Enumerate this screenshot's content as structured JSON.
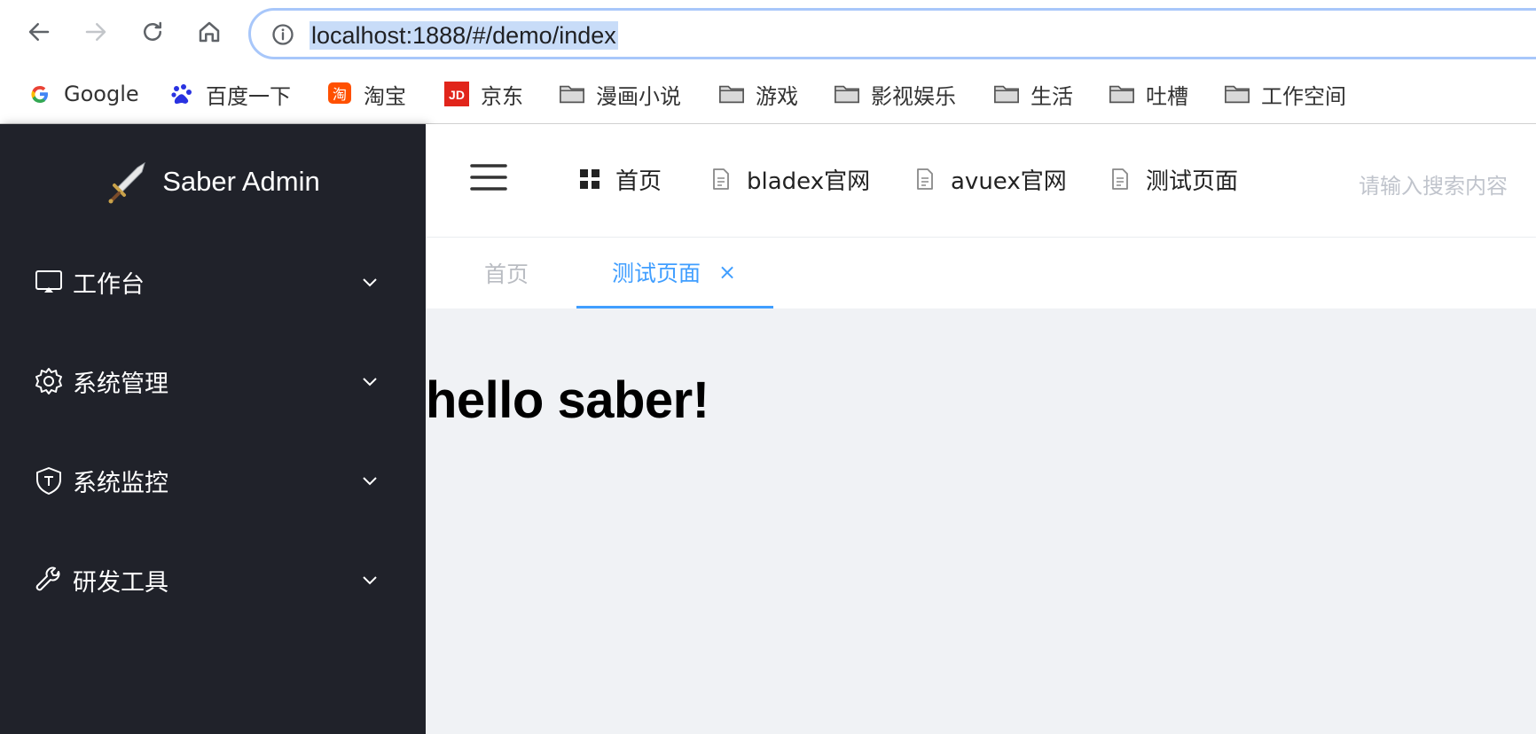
{
  "browser": {
    "url": "localhost:1888/#/demo/index",
    "icons": [
      "back-arrow-icon",
      "forward-arrow-icon",
      "reload-icon",
      "home-icon",
      "info-icon"
    ]
  },
  "bookmarks": [
    {
      "label": "Google",
      "icon": "google-icon"
    },
    {
      "label": "百度一下",
      "icon": "baidu-paw-icon"
    },
    {
      "label": "淘宝",
      "icon": "taobao-icon"
    },
    {
      "label": "京东",
      "icon": "jd-icon"
    },
    {
      "label": "漫画小说",
      "icon": "folder-icon"
    },
    {
      "label": "游戏",
      "icon": "folder-icon"
    },
    {
      "label": "影视娱乐",
      "icon": "folder-icon"
    },
    {
      "label": "生活",
      "icon": "folder-icon"
    },
    {
      "label": "吐槽",
      "icon": "folder-icon"
    },
    {
      "label": "工作空间",
      "icon": "folder-icon"
    }
  ],
  "sidebar": {
    "logo_text": "Saber Admin",
    "items": [
      {
        "label": "工作台",
        "icon": "monitor-icon"
      },
      {
        "label": "系统管理",
        "icon": "gear-icon"
      },
      {
        "label": "系统监控",
        "icon": "shield-icon"
      },
      {
        "label": "研发工具",
        "icon": "wrench-icon"
      }
    ]
  },
  "header": {
    "nav": [
      {
        "label": "首页",
        "icon": "grid-icon"
      },
      {
        "label": "bladex官网",
        "icon": "document-icon"
      },
      {
        "label": "avuex官网",
        "icon": "document-icon"
      },
      {
        "label": "测试页面",
        "icon": "document-icon"
      }
    ],
    "search_placeholder": "请输入搜索内容"
  },
  "tags": [
    {
      "label": "首页",
      "active": false
    },
    {
      "label": "测试页面",
      "active": true,
      "close": "×"
    }
  ],
  "content": {
    "heading": "hello saber!"
  },
  "colors": {
    "sidebar_bg": "#20222a",
    "accent": "#409eff",
    "content_bg": "#f0f2f5",
    "address_border": "#a8c7fa",
    "url_highlight": "#c8dcf8"
  }
}
